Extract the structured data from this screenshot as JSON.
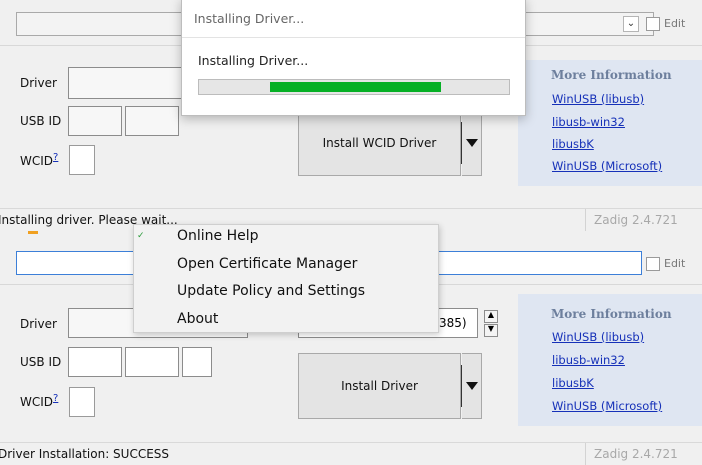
{
  "top": {
    "edit_label": "Edit",
    "driver_label": "Driver",
    "usb_id_label": "USB ID",
    "wcid_label": "WCID",
    "wcid_sup": "?",
    "install_button": "Install WCID Driver",
    "more_info": {
      "title": "More Information",
      "links": [
        "WinUSB (libusb)",
        "libusb-win32",
        "libusbK",
        "WinUSB (Microsoft)"
      ]
    },
    "status_text": "Installing driver. Please wait...",
    "version": "Zadig 2.4.721"
  },
  "dialog": {
    "title": "Installing Driver...",
    "message": "Installing Driver...",
    "progress": 0.78,
    "progress_start": 0.23,
    "fill_color": "#06b025"
  },
  "bottom": {
    "edit_label": "Edit",
    "driver_label": "Driver",
    "driver_version_fragment": "385)",
    "usb_id_label": "USB ID",
    "wcid_label": "WCID",
    "wcid_sup": "?",
    "install_button": "Install Driver",
    "more_info": {
      "title": "More Information",
      "links": [
        "WinUSB (libusb)",
        "libusb-win32",
        "libusbK",
        "WinUSB (Microsoft)"
      ]
    },
    "status_text": "Driver Installation: SUCCESS",
    "version": "Zadig 2.4.721"
  },
  "context_menu": {
    "items": [
      "Online Help",
      "Open Certificate Manager",
      "Update Policy and Settings",
      "About"
    ]
  }
}
